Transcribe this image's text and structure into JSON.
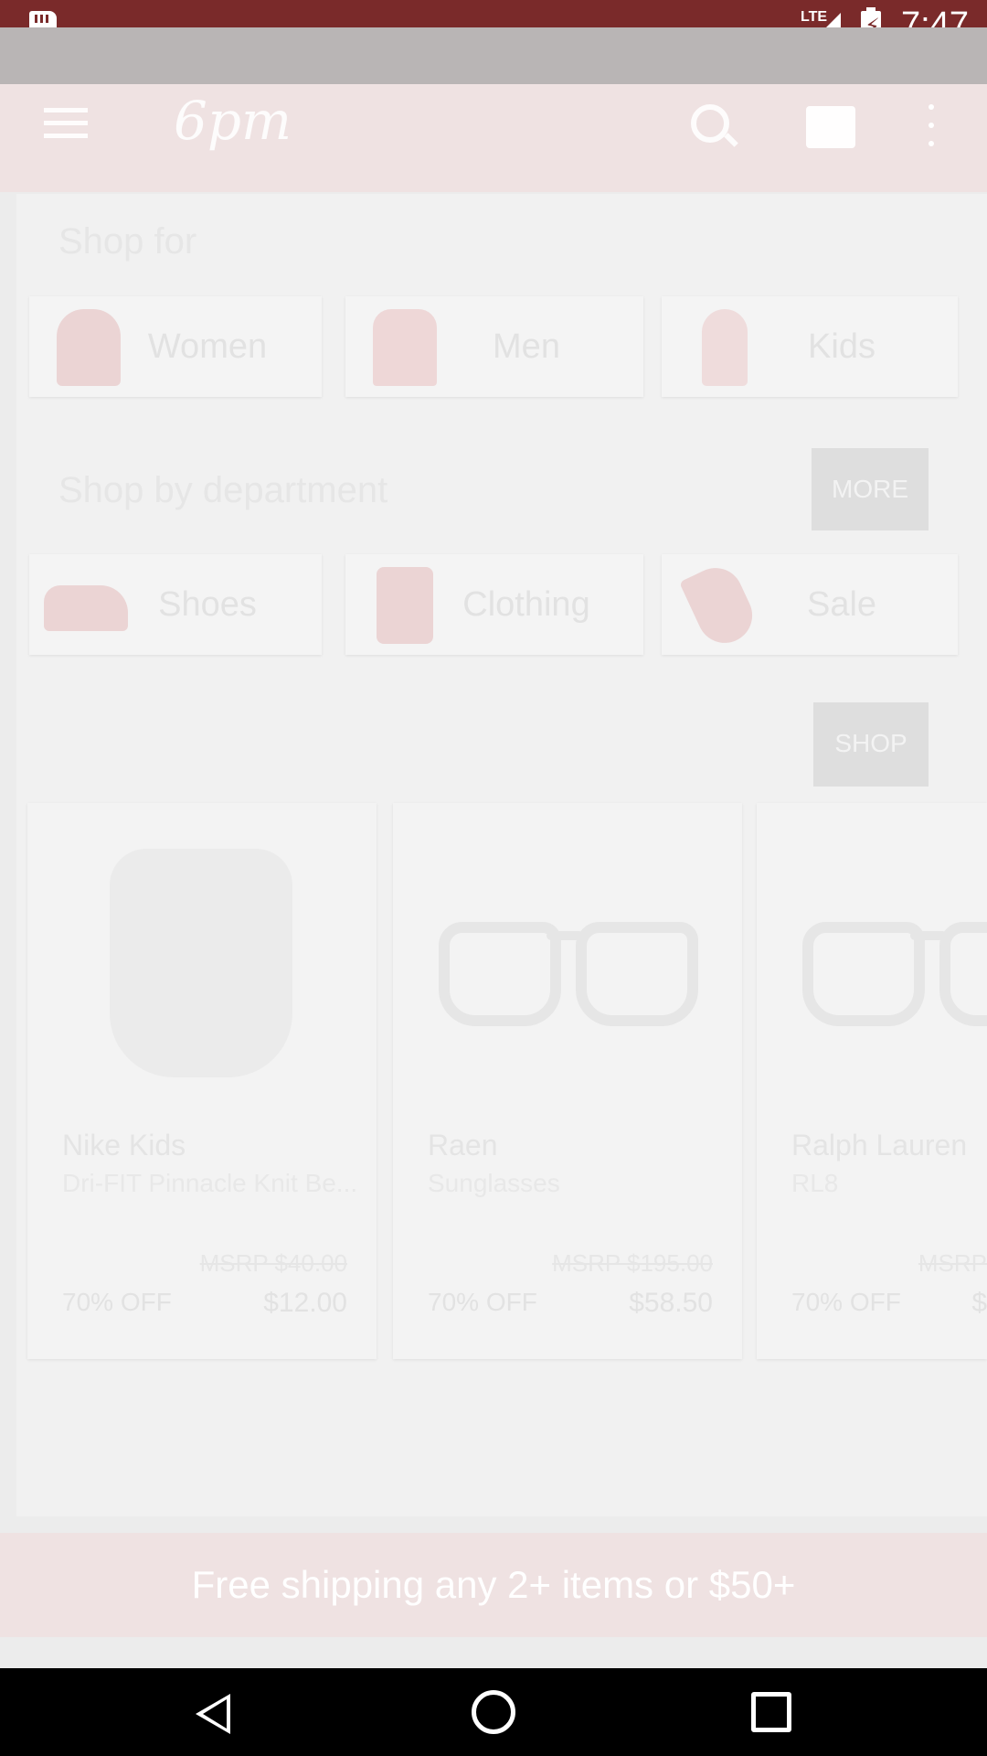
{
  "status_bar": {
    "network": "LTE",
    "time": "7:47"
  },
  "app_bar": {
    "logo_text": "6pm"
  },
  "shop_for": {
    "title": "Shop for",
    "items": [
      {
        "label": "Women",
        "icon": "woman-icon"
      },
      {
        "label": "Men",
        "icon": "man-icon"
      },
      {
        "label": "Kids",
        "icon": "kid-icon"
      }
    ]
  },
  "shop_by_department": {
    "title": "Shop by department",
    "more_label": "MORE",
    "items": [
      {
        "label": "Shoes",
        "icon": "shoe-icon"
      },
      {
        "label": "Clothing",
        "icon": "shirt-icon"
      },
      {
        "label": "Sale",
        "icon": "tag-icon"
      }
    ]
  },
  "featured": {
    "shop_label": "SHOP",
    "products": [
      {
        "brand": "Nike Kids",
        "name": "Dri-FIT Pinnacle Knit Be...",
        "original_price": "MSRP $40.00",
        "sale_text": "70% OFF",
        "price": "$12.00"
      },
      {
        "brand": "Raen",
        "name": "Sunglasses",
        "original_price": "MSRP $195.00",
        "sale_text": "70% OFF",
        "price": "$58.50"
      },
      {
        "brand": "Ralph Lauren",
        "name": "RL8",
        "original_price": "MSRP",
        "sale_text": "70% OFF",
        "price": "$"
      }
    ]
  },
  "banner": {
    "text": "Free shipping any 2+ items or $50+"
  }
}
